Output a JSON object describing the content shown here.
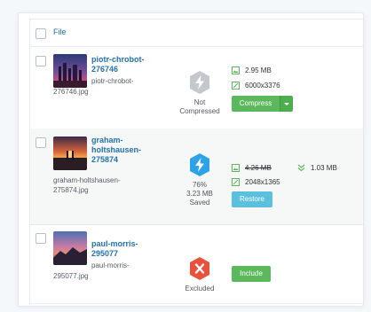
{
  "header": {
    "file_label": "File"
  },
  "rows": [
    {
      "title": "piotr-chrobot-276746",
      "title_lines": [
        "piotr-chrobot-",
        "276746"
      ],
      "filename_lines": [
        "piotr-chrobot-",
        "276746.jpg"
      ],
      "status_lines": [
        "Not",
        "Compressed"
      ],
      "status_icon": "bolt-gray-icon",
      "size": "2.95 MB",
      "dimensions": "6000x3376",
      "action_label": "Compress"
    },
    {
      "title": "graham-holtshausen-275874",
      "title_lines": [
        "graham-",
        "holtshausen-",
        "275874"
      ],
      "filename_lines": [
        "graham-holtshausen-",
        "275874.jpg"
      ],
      "status_lines": [
        "76%",
        "3.23 MB",
        "Saved"
      ],
      "status_icon": "bolt-blue-icon",
      "original_size": "4.26 MB",
      "compressed_size": "1.03 MB",
      "dimensions": "2048x1365",
      "action_label": "Restore"
    },
    {
      "title": "paul-morris-295077",
      "title_lines": [
        "paul-morris-",
        "295077"
      ],
      "filename_lines": [
        "paul-morris-",
        "295077.jpg"
      ],
      "status_lines": [
        "Excluded"
      ],
      "status_icon": "excluded-x-icon",
      "action_label": "Include"
    }
  ],
  "colors": {
    "link": "#2271b1",
    "compress_green": "#5cb85c",
    "restore_blue": "#5bc0de",
    "excluded_red": "#e8523d",
    "saved_blue": "#2ea2e8"
  }
}
